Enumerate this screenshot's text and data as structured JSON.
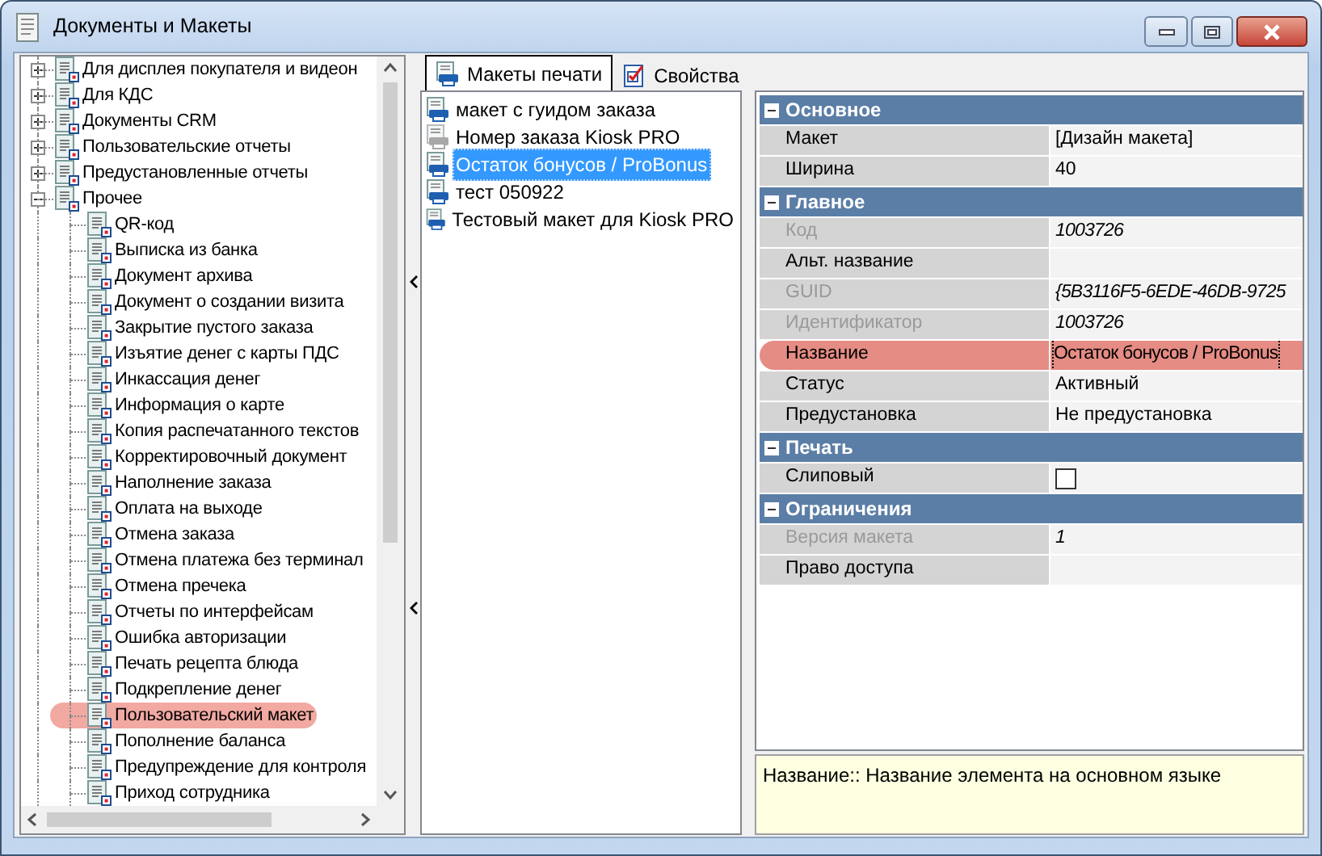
{
  "window": {
    "title": "Документы и Макеты"
  },
  "tree": {
    "items": [
      {
        "label": "Для дисплея покупателя и видеон",
        "expanded": false,
        "highlighted": false
      },
      {
        "label": "Для КДС",
        "expanded": false,
        "highlighted": false
      },
      {
        "label": "Документы CRM",
        "expanded": false,
        "highlighted": false
      },
      {
        "label": "Пользовательские отчеты",
        "expanded": false,
        "highlighted": false
      },
      {
        "label": "Предустановленные отчеты",
        "expanded": false,
        "highlighted": false
      },
      {
        "label": "Прочее",
        "expanded": true,
        "highlighted": false,
        "children": [
          {
            "label": "QR-код",
            "highlighted": false
          },
          {
            "label": "Выписка из банка",
            "highlighted": false
          },
          {
            "label": "Документ архива",
            "highlighted": false
          },
          {
            "label": "Документ о создании визита",
            "highlighted": false
          },
          {
            "label": "Закрытие пустого заказа",
            "highlighted": false
          },
          {
            "label": "Изъятие денег с карты ПДС",
            "highlighted": false
          },
          {
            "label": "Инкассация денег",
            "highlighted": false
          },
          {
            "label": "Информация о карте",
            "highlighted": false
          },
          {
            "label": "Копия распечатанного текстов",
            "highlighted": false
          },
          {
            "label": "Корректировочный документ",
            "highlighted": false
          },
          {
            "label": "Наполнение заказа",
            "highlighted": false
          },
          {
            "label": "Оплата на выходе",
            "highlighted": false
          },
          {
            "label": "Отмена заказа",
            "highlighted": false
          },
          {
            "label": "Отмена платежа без терминал",
            "highlighted": false
          },
          {
            "label": "Отмена пречека",
            "highlighted": false
          },
          {
            "label": "Отчеты по интерфейсам",
            "highlighted": false
          },
          {
            "label": "Ошибка авторизации",
            "highlighted": false
          },
          {
            "label": "Печать рецепта блюда",
            "highlighted": false
          },
          {
            "label": "Подкрепление денег",
            "highlighted": false
          },
          {
            "label": "Пользовательский макет",
            "highlighted": true
          },
          {
            "label": "Пополнение баланса",
            "highlighted": false
          },
          {
            "label": "Предупреждение для контроля",
            "highlighted": false
          },
          {
            "label": "Приход сотрудника",
            "highlighted": false
          }
        ]
      }
    ]
  },
  "tabs": [
    {
      "label": "Макеты печати",
      "selected": true
    },
    {
      "label": "Свойства",
      "selected": false
    }
  ],
  "layouts": [
    {
      "label": "макет с гуидом заказа",
      "selected": false,
      "disabled": false
    },
    {
      "label": "Номер заказа Kiosk PRO",
      "selected": false,
      "disabled": true
    },
    {
      "label": "Остаток бонусов / ProBonus",
      "selected": true,
      "disabled": false
    },
    {
      "label": "тест 050922",
      "selected": false,
      "disabled": false
    },
    {
      "label": "Тестовый макет для Kiosk PRO",
      "selected": false,
      "disabled": false
    }
  ],
  "properties": {
    "sections": [
      {
        "title": "Основное",
        "expanded": true,
        "rows": [
          {
            "label": "Макет",
            "value": "[Дизайн макета]",
            "kind": "text",
            "readonly": false,
            "highlighted": false,
            "focused": false
          },
          {
            "label": "Ширина",
            "value": "40",
            "kind": "text",
            "readonly": false,
            "highlighted": false,
            "focused": false
          }
        ]
      },
      {
        "title": "Главное",
        "expanded": true,
        "rows": [
          {
            "label": "Код",
            "value": "1003726",
            "kind": "text",
            "readonly": true,
            "highlighted": false,
            "focused": false
          },
          {
            "label": "Альт. название",
            "kind": "text",
            "readonly": false,
            "highlighted": false,
            "focused": false
          },
          {
            "label": "GUID",
            "value": "{5B3116F5-6EDE-46DB-9725",
            "kind": "text",
            "readonly": true,
            "highlighted": false,
            "focused": false
          },
          {
            "label": "Идентификатор",
            "value": "1003726",
            "kind": "text",
            "readonly": true,
            "highlighted": false,
            "focused": false
          },
          {
            "label": "Название",
            "value": "Остаток бонусов / ProBonus",
            "kind": "text",
            "readonly": false,
            "highlighted": true,
            "focused": true
          },
          {
            "label": "Статус",
            "value": "Активный",
            "kind": "text",
            "readonly": false,
            "highlighted": false,
            "focused": false
          },
          {
            "label": "Предустановка",
            "value": "Не предустановка",
            "kind": "text",
            "readonly": false,
            "highlighted": false,
            "focused": false
          }
        ]
      },
      {
        "title": "Печать",
        "expanded": true,
        "rows": [
          {
            "label": "Слиповый",
            "kind": "checkbox",
            "checked": false,
            "readonly": false,
            "highlighted": false,
            "focused": false
          }
        ]
      },
      {
        "title": "Ограничения",
        "expanded": true,
        "rows": [
          {
            "label": "Версия макета",
            "value": "1",
            "kind": "text",
            "readonly": true,
            "highlighted": false,
            "focused": false
          },
          {
            "label": "Право доступа",
            "kind": "text",
            "readonly": false,
            "highlighted": false,
            "focused": false
          }
        ]
      }
    ]
  },
  "description": "Название:: Название элемента на основном языке"
}
